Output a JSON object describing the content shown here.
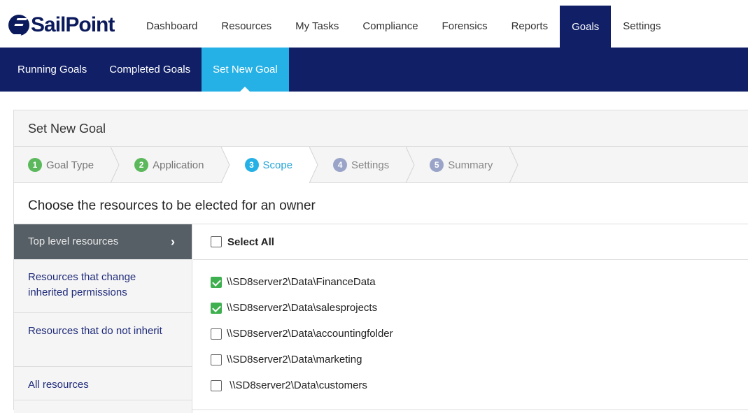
{
  "brand": {
    "name": "SailPoint"
  },
  "topnav": {
    "items": [
      {
        "label": "Dashboard"
      },
      {
        "label": "Resources"
      },
      {
        "label": "My Tasks"
      },
      {
        "label": "Compliance"
      },
      {
        "label": "Forensics"
      },
      {
        "label": "Reports"
      },
      {
        "label": "Goals"
      },
      {
        "label": "Settings"
      }
    ],
    "active": "Goals"
  },
  "subnav": {
    "items": [
      {
        "label": "Running Goals"
      },
      {
        "label": "Completed Goals"
      },
      {
        "label": "Set New Goal"
      }
    ],
    "active": "Set New Goal"
  },
  "panel": {
    "title": "Set New Goal",
    "steps": [
      {
        "num": "1",
        "label": "Goal Type",
        "state": "done"
      },
      {
        "num": "2",
        "label": "Application",
        "state": "done"
      },
      {
        "num": "3",
        "label": "Scope",
        "state": "current"
      },
      {
        "num": "4",
        "label": "Settings",
        "state": "todo"
      },
      {
        "num": "5",
        "label": "Summary",
        "state": "todo"
      }
    ],
    "instruction": "Choose the resources to be elected for an owner"
  },
  "left_nav": {
    "items": [
      {
        "label": "Top level resources",
        "active": true
      },
      {
        "label": "Resources that change inherited permissions"
      },
      {
        "label": "Resources that do not inherit"
      },
      {
        "label": "All resources"
      }
    ]
  },
  "resources": {
    "select_all_label": "Select All",
    "select_all_checked": false,
    "items": [
      {
        "path": "\\\\SD8server2\\Data\\FinanceData",
        "checked": true
      },
      {
        "path": "\\\\SD8server2\\Data\\salesprojects",
        "checked": true
      },
      {
        "path": "\\\\SD8server2\\Data\\accountingfolder",
        "checked": false
      },
      {
        "path": "\\\\SD8server2\\Data\\marketing",
        "checked": false
      },
      {
        "path": " \\\\SD8server2\\Data\\customers",
        "checked": false
      }
    ]
  },
  "colors": {
    "navy": "#101f66",
    "accent": "#25b1e5",
    "check_green": "#3fb04f",
    "left_active": "#565f66"
  }
}
